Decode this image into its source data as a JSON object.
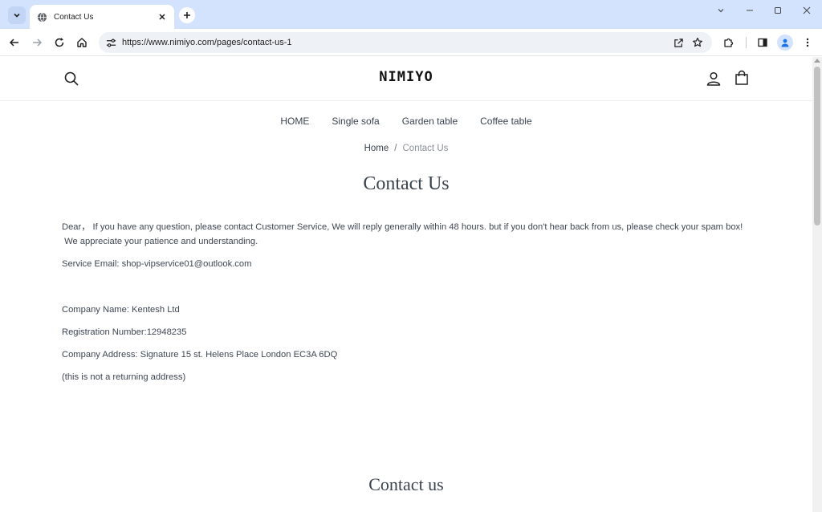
{
  "browser": {
    "tab_title": "Contact Us",
    "url": "https://www.nimiyo.com/pages/contact-us-1"
  },
  "site": {
    "logo": "NIMIYO",
    "nav": [
      "HOME",
      "Single sofa",
      "Garden table",
      "Coffee table"
    ]
  },
  "breadcrumb": {
    "home": "Home",
    "separator": "/",
    "current": "Contact Us"
  },
  "page": {
    "title": "Contact Us",
    "paragraph_line1": "Dear， If you have any question, please contact Customer Service, We will reply generally within 48 hours. but if you don't hear back from us, please check your spam box!",
    "paragraph_line2": " We appreciate your patience and understanding.",
    "service_email": "Service Email: shop-vipservice01@outlook.com",
    "company_name": "Company Name: Kentesh Ltd",
    "registration": "Registration Number:12948235",
    "address": "Company Address: Signature 15 st. Helens Place London EC3A 6DQ",
    "address_note": "(this is not a returning address)",
    "section_title": "Contact us"
  },
  "colors": {
    "tabbar": "#d3e3fd",
    "text": "#3a4350",
    "muted": "#8a8f96"
  }
}
